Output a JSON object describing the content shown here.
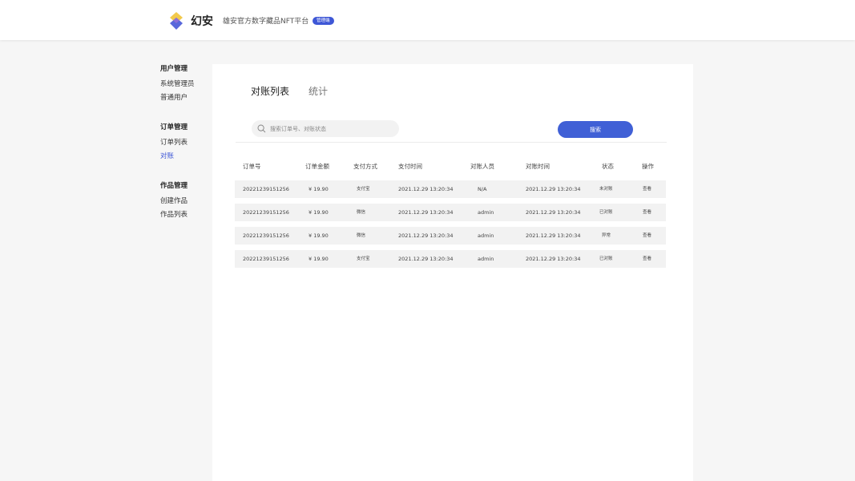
{
  "header": {
    "brand": "幻安",
    "subtitle": "雄安官方数字藏品NFT平台",
    "badge": "管理端",
    "logo_colors": [
      "#f2c94c",
      "#4b5bd8"
    ]
  },
  "sidebar": {
    "groups": [
      {
        "title": "用户管理",
        "items": [
          "系统管理员",
          "普通用户"
        ]
      },
      {
        "title": "订单管理",
        "items": [
          "订单列表",
          "对账"
        ]
      },
      {
        "title": "作品管理",
        "items": [
          "创建作品",
          "作品列表"
        ]
      }
    ],
    "active_item": "对账"
  },
  "tabs": [
    {
      "label": "对账列表",
      "active": true
    },
    {
      "label": "统计",
      "active": false
    }
  ],
  "search": {
    "placeholder": "搜索订单号、对账状态",
    "value": "",
    "button_label": "搜索"
  },
  "table": {
    "headers": [
      "订单号",
      "订单金额",
      "支付方式",
      "支付时间",
      "对账人员",
      "对账时间",
      "状态",
      "操作"
    ],
    "rows": [
      [
        "20221239151256",
        "¥ 19.90",
        "支付宝",
        "2021.12.29 13:20:34",
        "N/A",
        "2021.12.29 13:20:34",
        "未对账",
        "查看"
      ],
      [
        "20221239151256",
        "¥ 19.90",
        "微信",
        "2021.12.29 13:20:34",
        "admin",
        "2021.12.29 13:20:34",
        "已对账",
        "查看"
      ],
      [
        "20221239151256",
        "¥ 19.90",
        "微信",
        "2021.12.29 13:20:34",
        "admin",
        "2021.12.29 13:20:34",
        "异常",
        "查看"
      ],
      [
        "20221239151256",
        "¥ 19.90",
        "支付宝",
        "2021.12.29 13:20:34",
        "admin",
        "2021.12.29 13:20:34",
        "已对账",
        "查看"
      ]
    ]
  },
  "colors": {
    "accent": "#3e57d6",
    "button": "#4060d6",
    "row_bg": "#f2f2f2",
    "page_bg": "#f6f6f6"
  }
}
